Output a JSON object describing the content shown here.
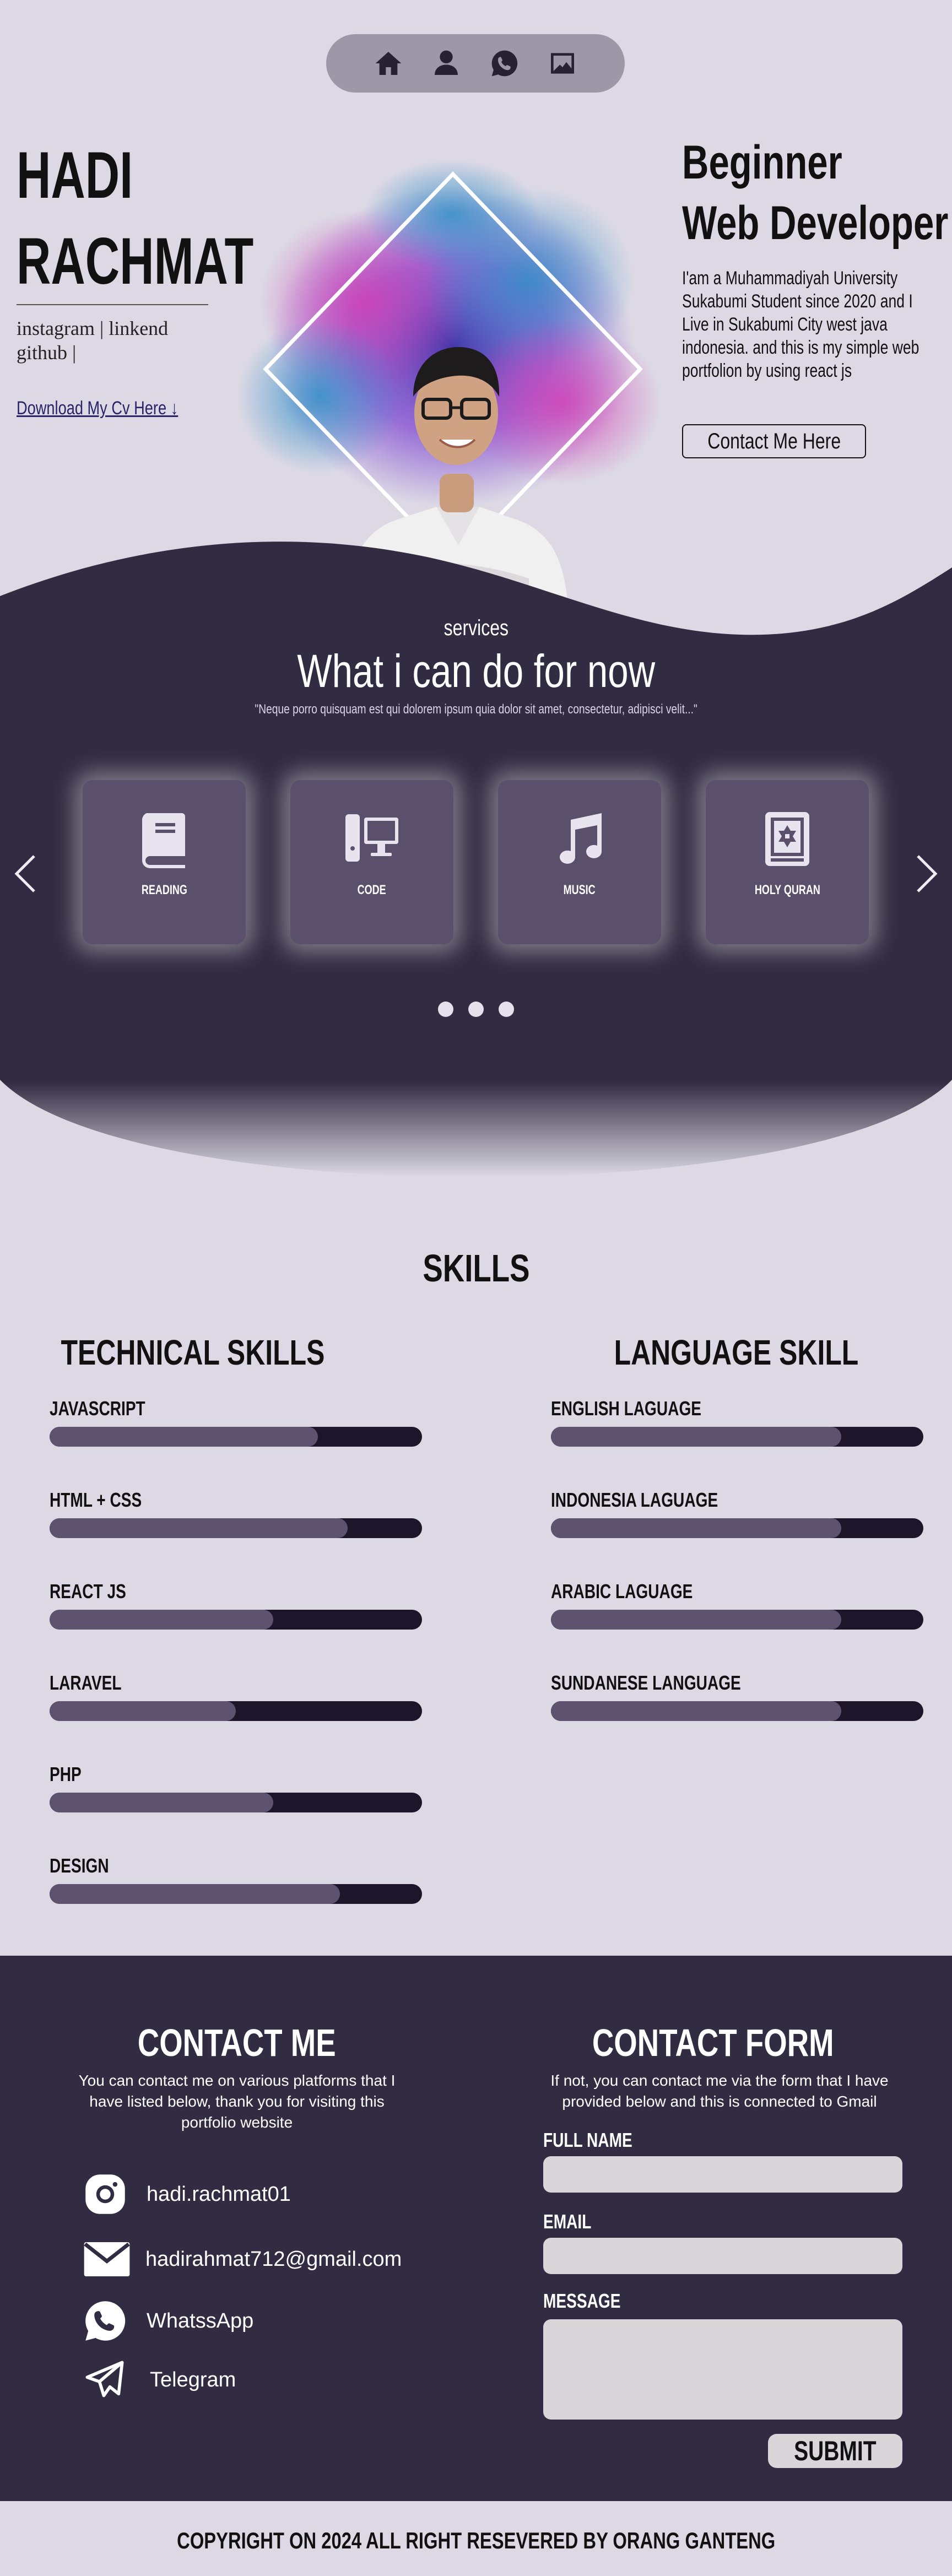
{
  "nav": {
    "items": [
      {
        "icon": "home-icon"
      },
      {
        "icon": "user-icon"
      },
      {
        "icon": "whatsapp-icon"
      },
      {
        "icon": "image-icon"
      }
    ]
  },
  "hero": {
    "name_line1": "HADI",
    "name_line2": "RACHMAT",
    "social_instagram": "instagram",
    "social_sep1": " | ",
    "social_linkedin": "linkend",
    "social_github": "github",
    "social_sep2": " |",
    "cv_link": "Download My Cv Here ↓",
    "title_line1": "Beginner",
    "title_line2": "Web Developer",
    "description": "I'am a Muhammadiyah University Sukabumi Student since 2020 and I Live in Sukabumi City west java indonesia. and this is my simple web portfolion by using react js",
    "contact_button": "Contact Me Here"
  },
  "services": {
    "kicker": "services",
    "title": "What i can do for now",
    "quote": "\"Neque porro quisquam est qui dolorem ipsum quia dolor sit amet, consectetur, adipisci velit...\"",
    "cards": [
      {
        "label": "READING",
        "icon": "book-icon"
      },
      {
        "label": "CODE",
        "icon": "computer-icon"
      },
      {
        "label": "MUSIC",
        "icon": "music-note-icon"
      },
      {
        "label": "HOLY QURAN",
        "icon": "quran-icon"
      }
    ],
    "carousel_dots": 3
  },
  "skills": {
    "title": "SKILLS",
    "technical": {
      "title": "TECHNICAL SKILLS",
      "items": [
        {
          "name": "JAVASCRIPT",
          "level": 0.72
        },
        {
          "name": "HTML + CSS",
          "level": 0.8
        },
        {
          "name": "REACT JS",
          "level": 0.6
        },
        {
          "name": "LARAVEL",
          "level": 0.5
        },
        {
          "name": "PHP",
          "level": 0.6
        },
        {
          "name": "DESIGN",
          "level": 0.78
        }
      ]
    },
    "language": {
      "title": "LANGUAGE SKILL",
      "items": [
        {
          "name": "ENGLISH LAGUAGE",
          "level": 0.78
        },
        {
          "name": "INDONESIA LAGUAGE",
          "level": 0.78
        },
        {
          "name": "ARABIC LAGUAGE",
          "level": 0.78
        },
        {
          "name": "SUNDANESE LANGUAGE",
          "level": 0.78
        }
      ]
    }
  },
  "contact": {
    "title": "CONTACT ME",
    "intro": "You can contact me on various platforms that I have listed below, thank you for visiting this portfolio website",
    "items": [
      {
        "icon": "instagram-icon",
        "label": "hadi.rachmat01"
      },
      {
        "icon": "mail-icon",
        "label": "hadirahmat712@gmail.com"
      },
      {
        "icon": "whatsapp-icon",
        "label": "WhatssApp"
      },
      {
        "icon": "telegram-icon",
        "label": "Telegram"
      }
    ]
  },
  "form": {
    "title": "CONTACT FORM",
    "intro": "If not, you can contact me via the form that I have provided below and this is connected to Gmail",
    "name_label": "FULL NAME",
    "name_value": "",
    "email_label": "EMAIL",
    "email_value": "",
    "message_label": "MESSAGE",
    "message_value": "",
    "submit_label": "SUBMIT"
  },
  "footer": {
    "copyright": "COPYRIGHT ON 2024 ALL RIGHT RESEVERED BY ORANG GANTENG"
  },
  "colors": {
    "page_bg": "#dcd9e5",
    "dark_section": "#322c42",
    "card": "#5b506c",
    "bar_track": "#1d1529",
    "bar_fill": "#5d536f"
  }
}
